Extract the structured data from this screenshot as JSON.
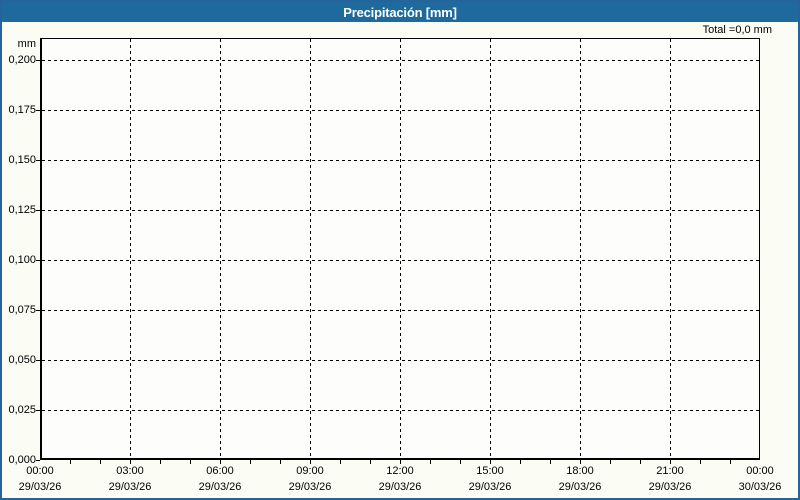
{
  "window": {
    "title": "Precipitación [mm]"
  },
  "header": {
    "total_label": "Total =0,0 mm"
  },
  "colors": {
    "title_bar_bg": "#1e6a9d",
    "title_bar_text": "#ffffff",
    "frame_border": "#24639b",
    "grid_color": "#000000",
    "plot_bg": "#fdfdfb",
    "page_bg": "#fbfcf4",
    "label_color": "#000000"
  },
  "chart_data": {
    "type": "line",
    "title": "Precipitación [mm]",
    "xlabel": "",
    "ylabel": "mm",
    "unit_label": "mm",
    "ylim": [
      0.0,
      0.21
    ],
    "xlim_hours": [
      0,
      24
    ],
    "grid": true,
    "grid_style": "dashed",
    "legend_position": "none",
    "y_ticks": [
      {
        "label": "0,200",
        "value": 0.2
      },
      {
        "label": "0,175",
        "value": 0.175
      },
      {
        "label": "0,150",
        "value": 0.15
      },
      {
        "label": "0,125",
        "value": 0.125
      },
      {
        "label": "0,100",
        "value": 0.1
      },
      {
        "label": "0,075",
        "value": 0.075
      },
      {
        "label": "0,050",
        "value": 0.05
      },
      {
        "label": "0,025",
        "value": 0.025
      },
      {
        "label": "0,000",
        "value": 0.0
      }
    ],
    "x_ticks": [
      {
        "time": "00:00",
        "date": "29/03/26",
        "hour": 0
      },
      {
        "time": "03:00",
        "date": "29/03/26",
        "hour": 3
      },
      {
        "time": "06:00",
        "date": "29/03/26",
        "hour": 6
      },
      {
        "time": "09:00",
        "date": "29/03/26",
        "hour": 9
      },
      {
        "time": "12:00",
        "date": "29/03/26",
        "hour": 12
      },
      {
        "time": "15:00",
        "date": "29/03/26",
        "hour": 15
      },
      {
        "time": "18:00",
        "date": "29/03/26",
        "hour": 18
      },
      {
        "time": "21:00",
        "date": "29/03/26",
        "hour": 21
      },
      {
        "time": "00:00",
        "date": "30/03/26",
        "hour": 24
      }
    ],
    "minor_tick_interval_hours": 1,
    "series": [
      {
        "name": "Precipitación",
        "values": []
      }
    ],
    "total": "0,0 mm"
  }
}
